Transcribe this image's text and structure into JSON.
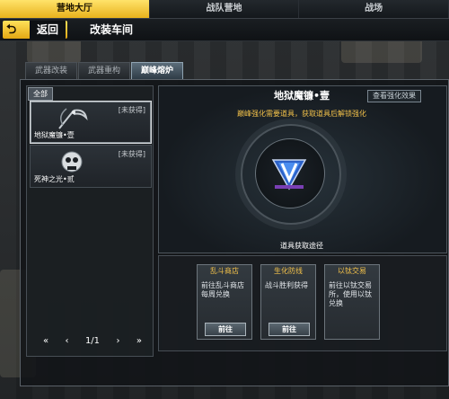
{
  "top_tabs": [
    {
      "label": "营地大厅",
      "active": true
    },
    {
      "label": "战队营地",
      "active": false
    },
    {
      "label": "战场",
      "active": false
    }
  ],
  "header": {
    "back_label": "返回",
    "title": "改装车间"
  },
  "sub_tabs": [
    {
      "label": "武器改装",
      "active": false
    },
    {
      "label": "武器重构",
      "active": false
    },
    {
      "label": "巅峰熔炉",
      "active": true
    }
  ],
  "list": {
    "filter": "全部",
    "items": [
      {
        "name": "地狱魔镰•壹",
        "status": "[未获得]",
        "selected": true,
        "icon": "scythe-icon"
      },
      {
        "name": "死神之光•贰",
        "status": "[未获得]",
        "selected": false,
        "icon": "skull-icon"
      }
    ],
    "pager": {
      "first": "«",
      "prev": "‹",
      "page": "1/1",
      "next": "›",
      "last": "»"
    }
  },
  "detail": {
    "title": "地狱魔镰•壹",
    "effect_link": "查看强化效果",
    "hint": "巅峰强化需要道具，获取道具后解锁强化",
    "acquisition_label": "道具获取途径",
    "gem_icon": "v-gem-icon"
  },
  "acquisition": [
    {
      "title": "乱斗商店",
      "desc": "前往乱斗商店每周兑换",
      "button": "前往"
    },
    {
      "title": "生化防线",
      "desc": "战斗胜利获得",
      "button": "前往"
    },
    {
      "title": "以钛交易",
      "desc": "前往以钛交易所，使用以钛兑换",
      "button": ""
    }
  ],
  "colors": {
    "accent": "#ffd84a",
    "hint": "#f2c14a",
    "panel": "#161b20"
  }
}
